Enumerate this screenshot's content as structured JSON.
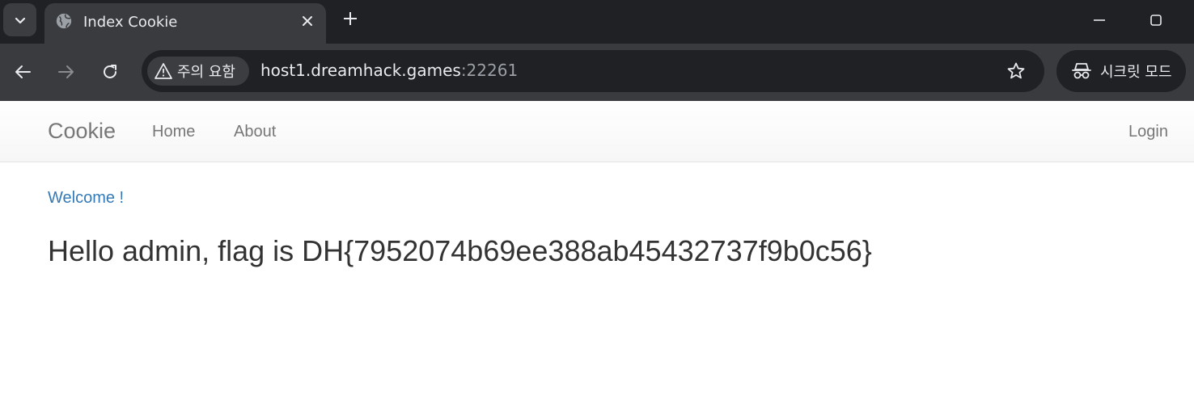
{
  "browser": {
    "tab": {
      "title": "Index Cookie"
    },
    "address": {
      "security_chip": "주의 요함",
      "host": "host1.dreamhack.games",
      "port": ":22261"
    },
    "incognito_label": "시크릿 모드"
  },
  "page": {
    "navbar": {
      "brand": "Cookie",
      "links": [
        "Home",
        "About"
      ],
      "login": "Login"
    },
    "welcome": "Welcome !",
    "message": "Hello admin, flag is DH{7952074b69ee388ab45432737f9b0c56}"
  }
}
